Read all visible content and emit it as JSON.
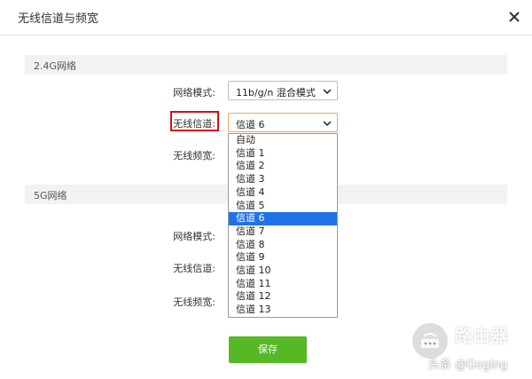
{
  "dialog": {
    "title": "无线信道与频宽"
  },
  "section_24g": {
    "title": "2.4G网络",
    "mode_label": "网络模式:",
    "mode_value": "11b/g/n 混合模式",
    "channel_label": "无线信道:",
    "channel_value": "信道 6",
    "bandwidth_label": "无线频宽:"
  },
  "section_5g": {
    "title": "5G网络",
    "mode_label": "网络模式:",
    "channel_label": "无线信道:",
    "bandwidth_label": "无线频宽:"
  },
  "dropdown": {
    "options": [
      "自动",
      "信道 1",
      "信道 2",
      "信道 3",
      "信道 4",
      "信道 5",
      "信道 6",
      "信道 7",
      "信道 8",
      "信道 9",
      "信道 10",
      "信道 11",
      "信道 12",
      "信道 13"
    ],
    "selected": "信道 6"
  },
  "actions": {
    "save_label": "保存"
  },
  "watermark": {
    "brand": "路由器",
    "credit": "头条 @Goging"
  },
  "colors": {
    "save_button": "#56b825",
    "highlight_border": "#d0101c",
    "selected_option": "#1e73e8"
  }
}
